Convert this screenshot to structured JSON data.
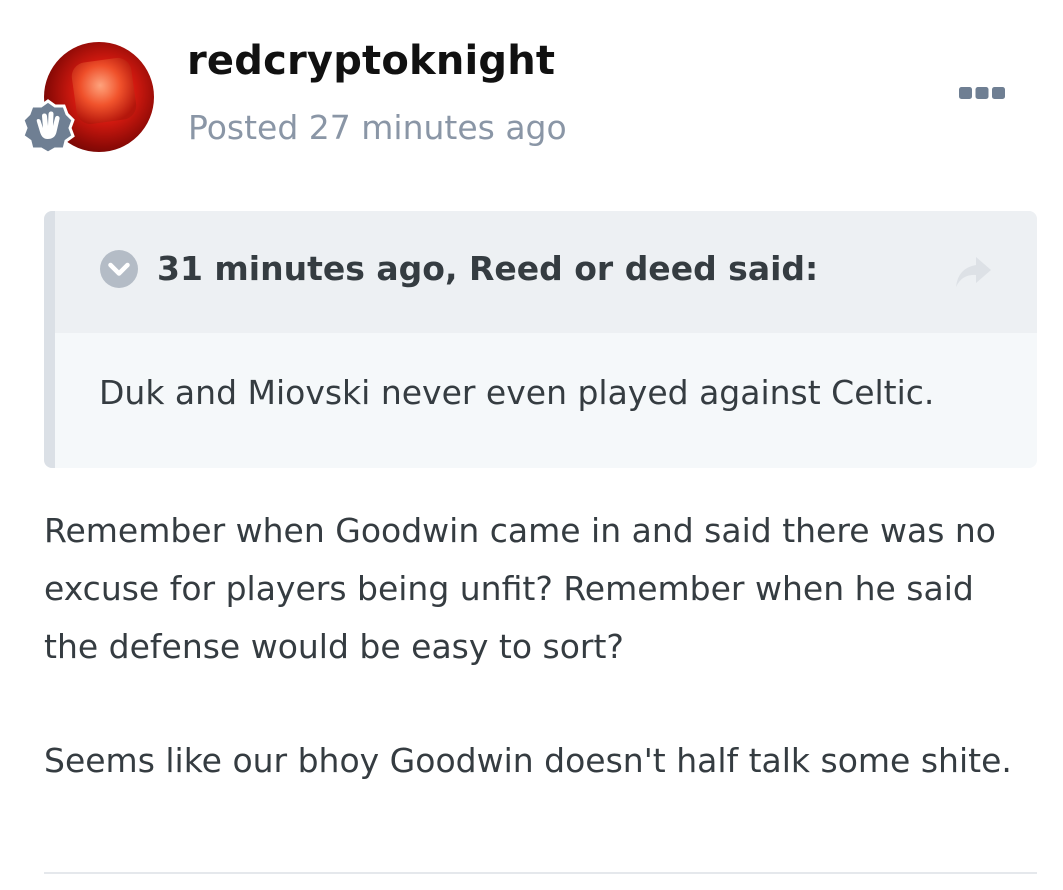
{
  "post": {
    "author": "redcryptoknight",
    "posted": "Posted 27 minutes ago",
    "avatar_icon": "avatar-image",
    "rank_icon": "waving-hand-badge-icon",
    "more_icon": "ellipsis-icon"
  },
  "quote": {
    "citation": "31 minutes ago, Reed or deed said:",
    "text": "Duk and Miovski never even played against Celtic.",
    "toggle_icon": "chevron-down-circle-icon",
    "share_icon": "share-arrow-icon"
  },
  "body": {
    "lines": [
      "Remember when Goodwin came in and said there was no",
      "excuse for players being unfit? Remember when he said",
      "the defense would be easy to sort?",
      "Seems like our bhoy Goodwin doesn't half talk some shite."
    ]
  },
  "colors": {
    "meta_text": "#8a96a6",
    "body_text": "#353c41",
    "quote_header_bg": "#edf0f3",
    "quote_body_bg": "#f5f8fa",
    "quote_bar": "#dbe0e6"
  }
}
